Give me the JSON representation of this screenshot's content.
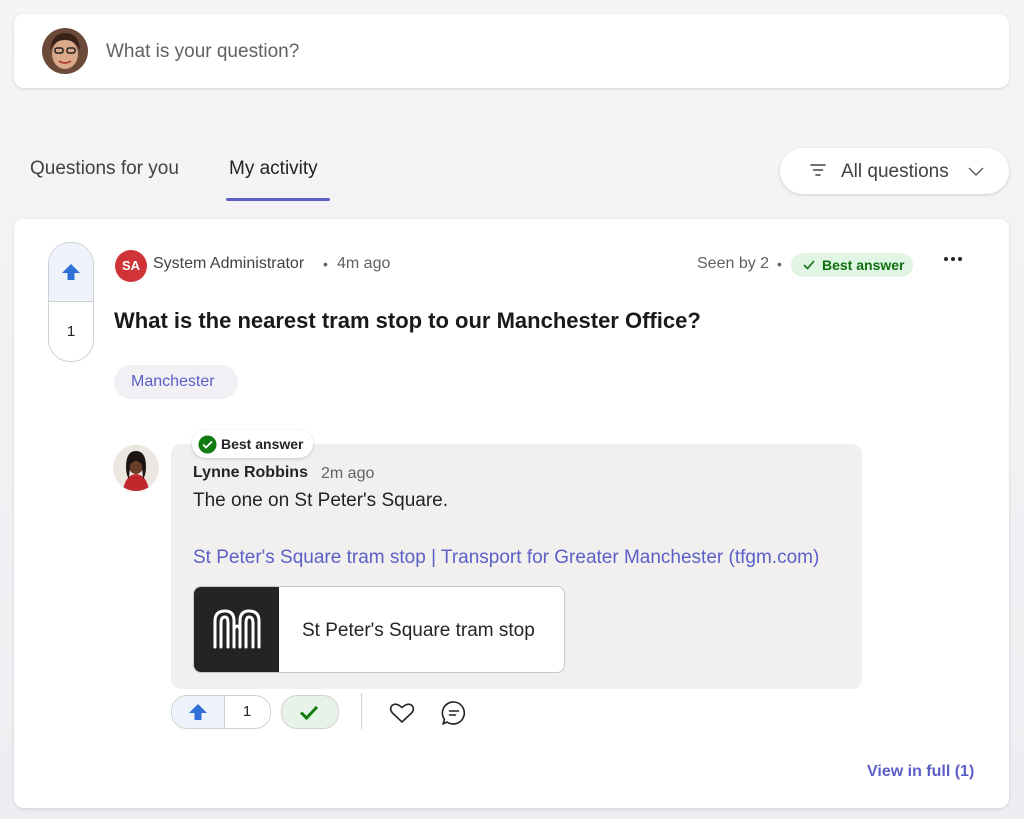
{
  "composer": {
    "placeholder": "What is your question?"
  },
  "tabs": [
    {
      "label": "Questions for you",
      "active": false
    },
    {
      "label": "My activity",
      "active": true
    }
  ],
  "filter": {
    "label": "All questions",
    "icon": "filter-icon"
  },
  "post": {
    "upvotes": "1",
    "author_initials": "SA",
    "author": "System Administrator",
    "time": "4m ago",
    "seen_by": "Seen by 2",
    "best_answer_pill": "Best answer",
    "title": "What is the nearest tram stop to our Manchester Office?",
    "tag": "Manchester",
    "colors": {
      "accent": "#5b5fc7",
      "avatar_red": "#d13438",
      "success_green": "#0e700e",
      "upvote_blue": "#2f6fd6"
    }
  },
  "answer": {
    "badge": "Best answer",
    "author": "Lynne Robbins",
    "time": "2m ago",
    "text": "The one on St Peter's Square.",
    "link_text": "St Peter's Square tram stop | Transport for Greater Manchester (tfgm.com)",
    "preview_title": "St Peter's Square tram stop",
    "upvotes": "1"
  },
  "footer": {
    "view_full": "View in full (1)"
  }
}
